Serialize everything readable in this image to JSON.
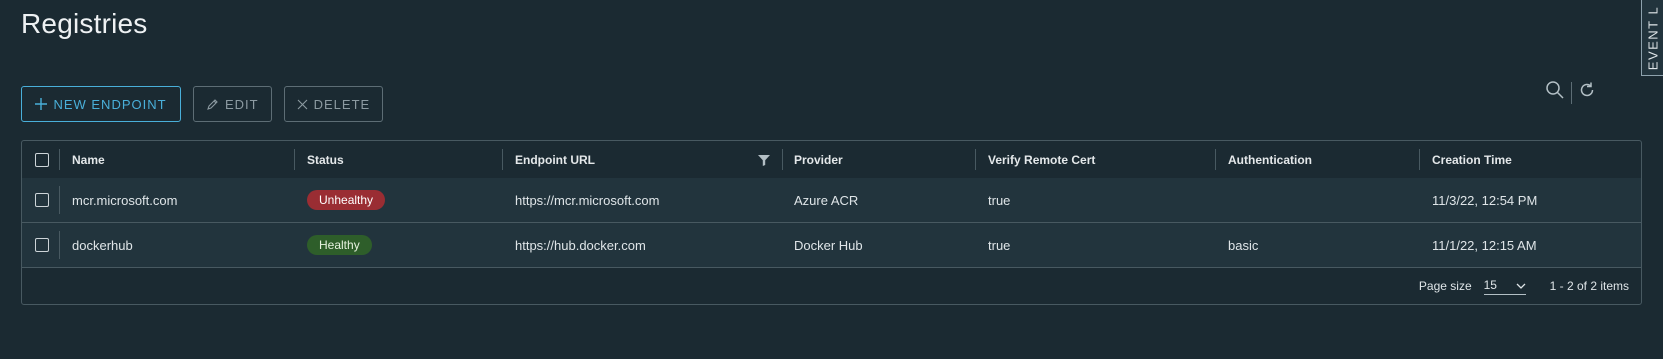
{
  "page": {
    "title": "Registries"
  },
  "event_tab": {
    "label": "EVENT L"
  },
  "toolbar": {
    "new_endpoint_label": "NEW ENDPOINT",
    "edit_label": "EDIT",
    "delete_label": "DELETE"
  },
  "grid": {
    "columns": [
      {
        "label": "Name"
      },
      {
        "label": "Status"
      },
      {
        "label": "Endpoint URL"
      },
      {
        "label": "Provider"
      },
      {
        "label": "Verify Remote Cert"
      },
      {
        "label": "Authentication"
      },
      {
        "label": "Creation Time"
      }
    ],
    "rows": [
      {
        "name": "mcr.microsoft.com",
        "status": "Unhealthy",
        "endpoint_url": "https://mcr.microsoft.com",
        "provider": "Azure ACR",
        "verify_remote_cert": "true",
        "authentication": "",
        "creation_time": "11/3/22, 12:54 PM"
      },
      {
        "name": "dockerhub",
        "status": "Healthy",
        "endpoint_url": "https://hub.docker.com",
        "provider": "Docker Hub",
        "verify_remote_cert": "true",
        "authentication": "basic",
        "creation_time": "11/1/22, 12:15 AM"
      }
    ],
    "footer": {
      "page_size_label": "Page size",
      "page_size_value": "15",
      "item_count": "1 - 2 of 2 items"
    }
  },
  "colors": {
    "background": "#1b2a32",
    "accent": "#49afd9",
    "unhealthy": "#9a2d33",
    "healthy": "#2e5e2a"
  },
  "icons": [
    "plus-icon",
    "pencil-icon",
    "close-icon",
    "search-icon",
    "refresh-icon",
    "filter-icon",
    "chevron-down-icon"
  ]
}
